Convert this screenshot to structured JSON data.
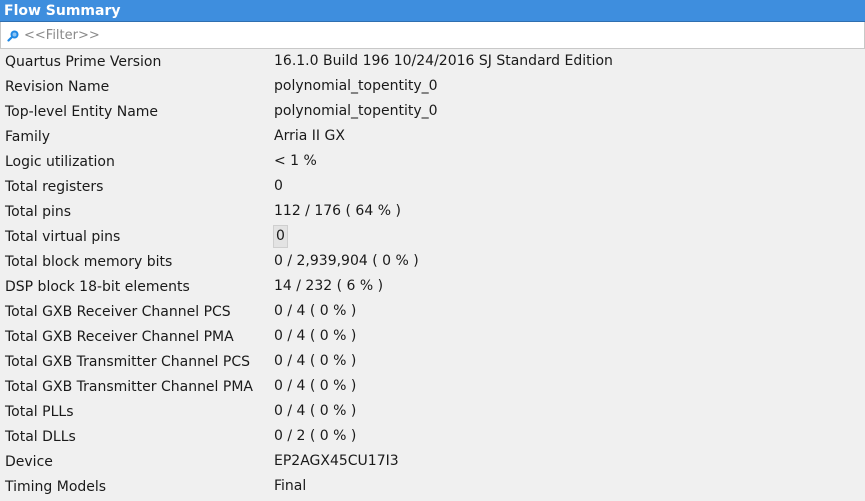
{
  "title": "Flow Summary",
  "filter": {
    "placeholder": "<<Filter>>"
  },
  "rows": [
    {
      "key": "Quartus Prime Version",
      "value": "16.1.0 Build 196 10/24/2016 SJ Standard Edition"
    },
    {
      "key": "Revision Name",
      "value": "polynomial_topentity_0"
    },
    {
      "key": "Top-level Entity Name",
      "value": "polynomial_topentity_0"
    },
    {
      "key": "Family",
      "value": "Arria II GX"
    },
    {
      "key": "Logic utilization",
      "value": "< 1 %"
    },
    {
      "key": "Total registers",
      "value": "0"
    },
    {
      "key": "Total pins",
      "value": "112 / 176 ( 64 % )"
    },
    {
      "key": "Total virtual pins",
      "value": "0"
    },
    {
      "key": "Total block memory bits",
      "value": "0 / 2,939,904 ( 0 % )"
    },
    {
      "key": "DSP block 18-bit elements",
      "value": "14 / 232 ( 6 % )"
    },
    {
      "key": "Total GXB Receiver Channel PCS",
      "value": "0 / 4 ( 0 % )"
    },
    {
      "key": "Total GXB Receiver Channel PMA",
      "value": "0 / 4 ( 0 % )"
    },
    {
      "key": "Total GXB Transmitter Channel PCS",
      "value": "0 / 4 ( 0 % )"
    },
    {
      "key": "Total GXB Transmitter Channel PMA",
      "value": "0 / 4 ( 0 % )"
    },
    {
      "key": "Total PLLs",
      "value": "0 / 4 ( 0 % )"
    },
    {
      "key": "Total DLLs",
      "value": "0 / 2 ( 0 % )"
    },
    {
      "key": "Device",
      "value": "EP2AGX45CU17I3"
    },
    {
      "key": "Timing Models",
      "value": "Final"
    }
  ],
  "icons": {
    "filter": "search-icon"
  },
  "colors": {
    "title_bar": "#3e8ede",
    "search_icon": "#1e88e5"
  }
}
